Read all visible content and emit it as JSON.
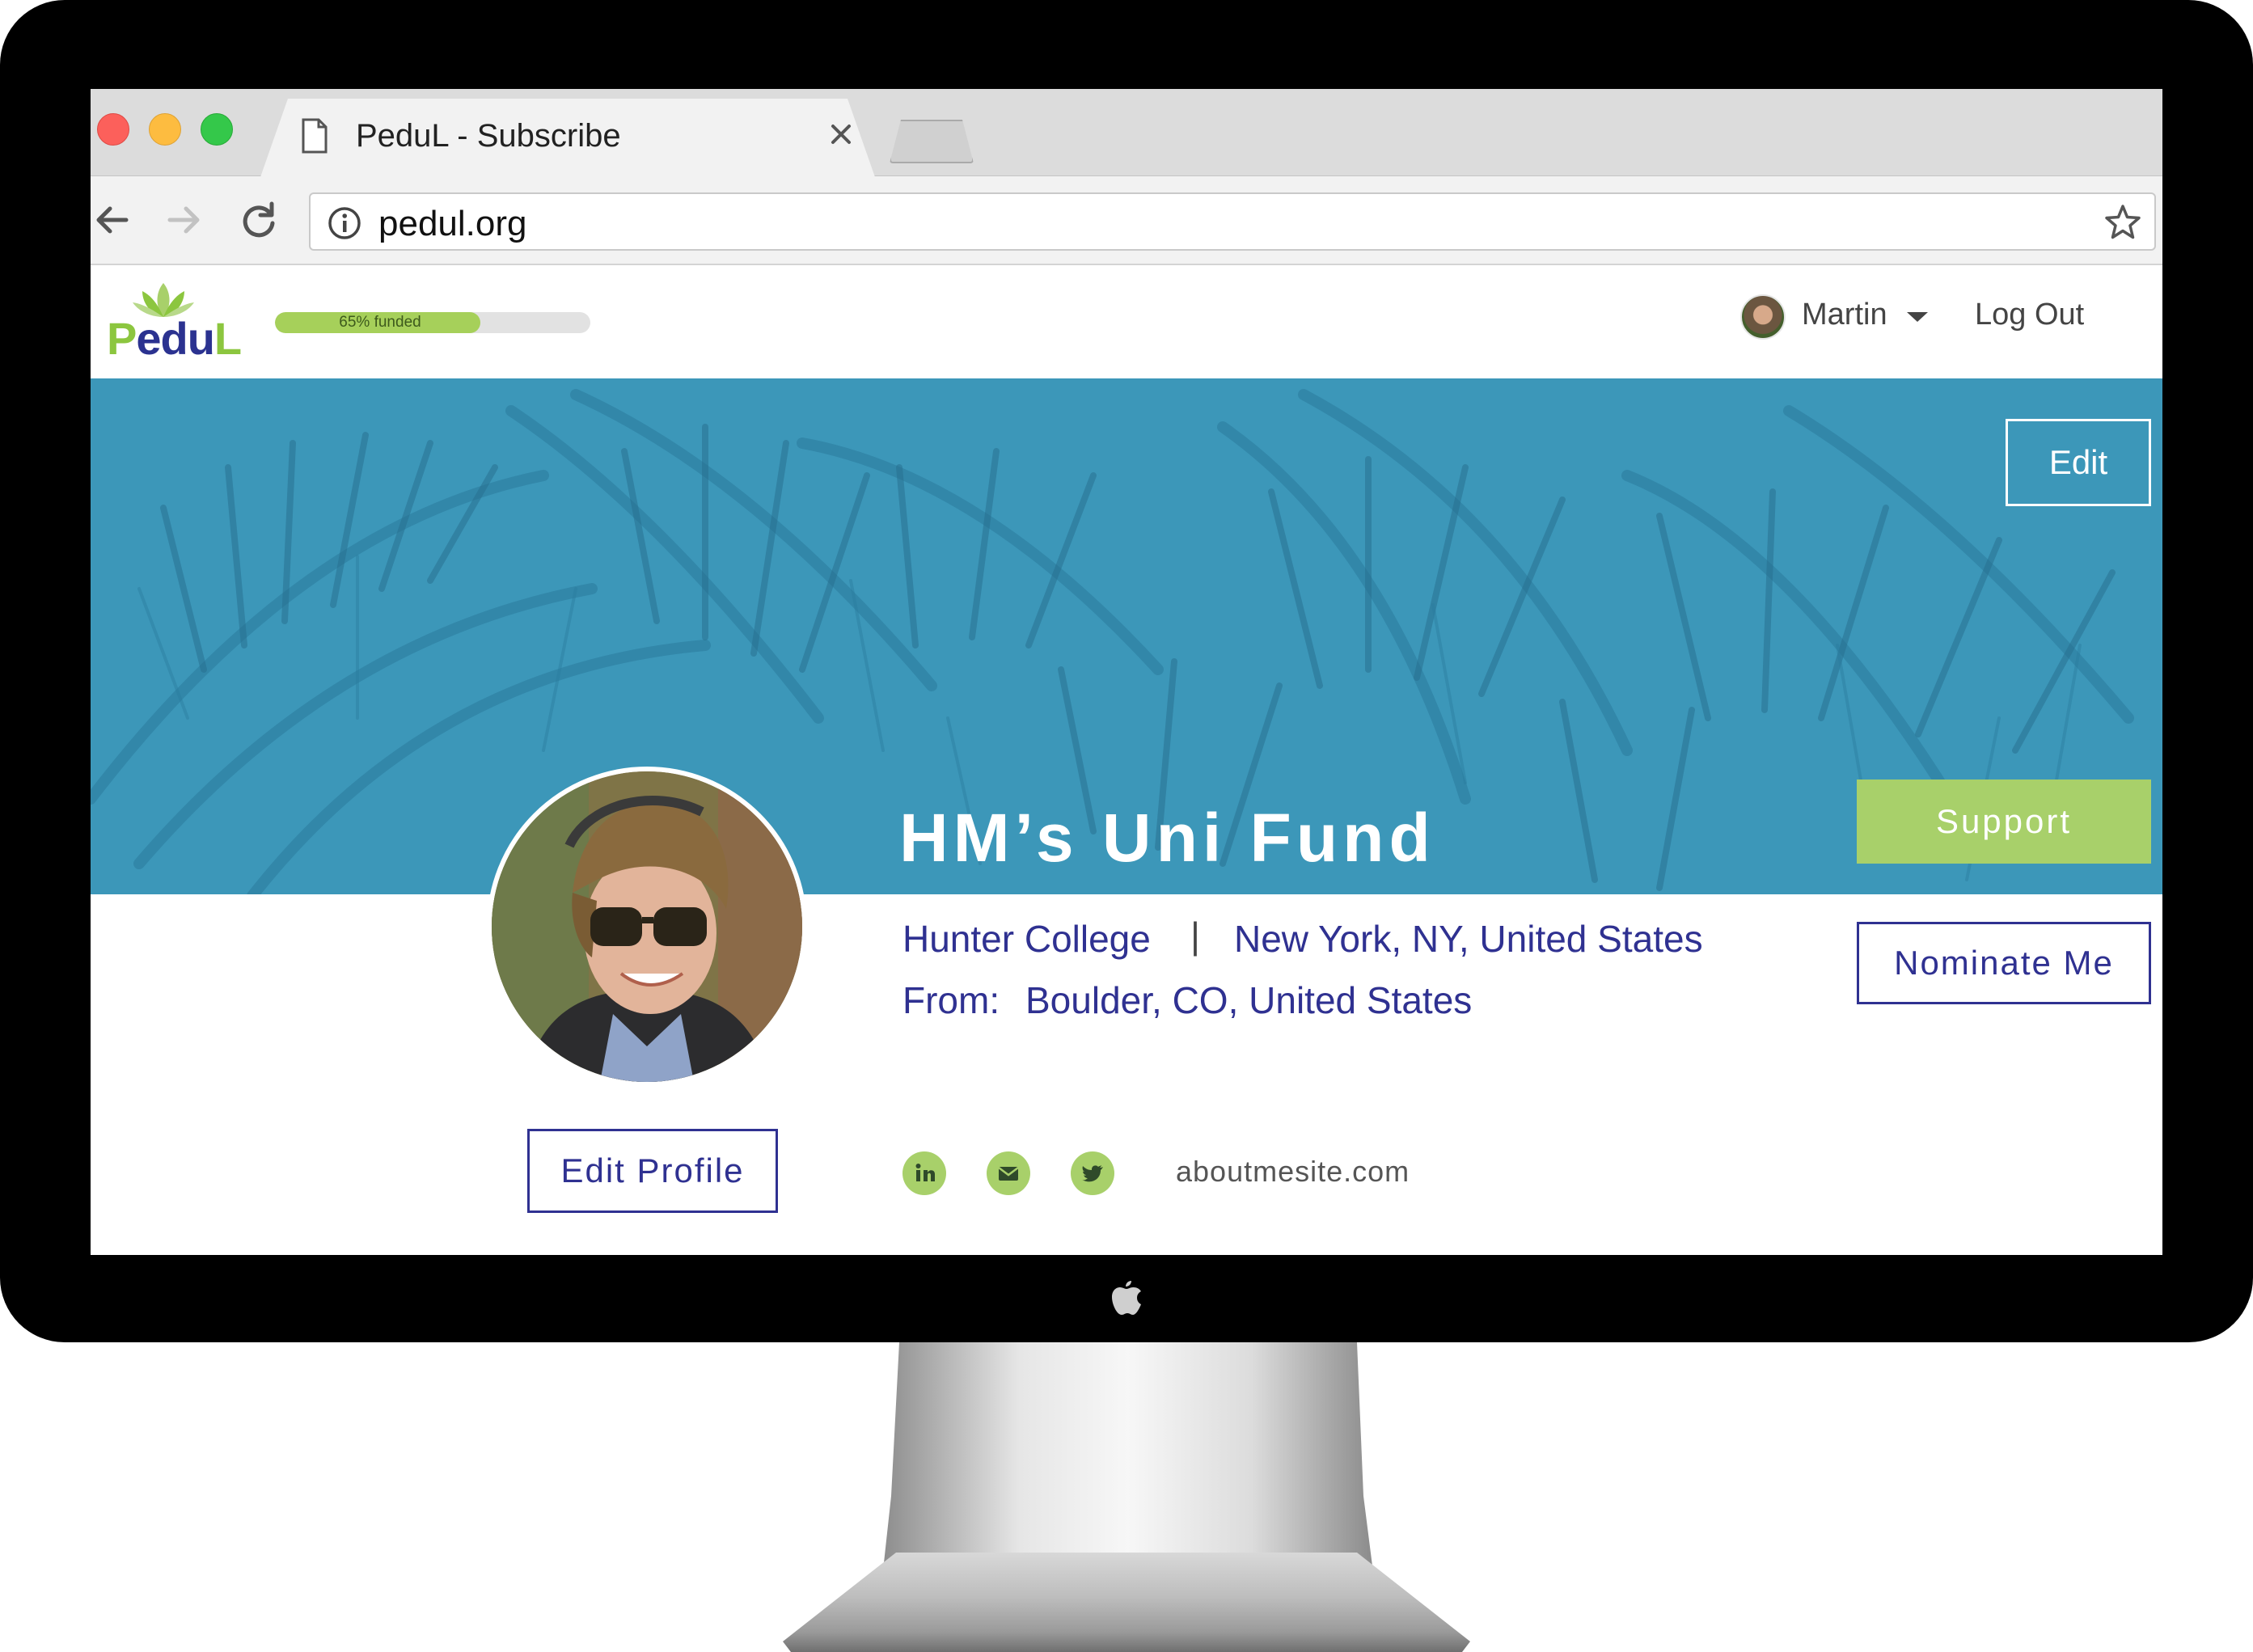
{
  "browser": {
    "tab_title": "PeduL - Subscribe",
    "url": "pedul.org"
  },
  "site": {
    "logo_text": "PeduL",
    "funding_label": "65% funded",
    "funding_fraction": 0.65,
    "user_name": "Martin",
    "logout_label": "Log Out"
  },
  "hero": {
    "edit_label": "Edit",
    "title": "HM’s Uni Fund",
    "support_label": "Support"
  },
  "profile": {
    "college": "Hunter College",
    "divider": "|",
    "location": "New York, NY, United States",
    "from_label": "From:",
    "from_value": "Boulder, CO, United States",
    "nominate_label": "Nominate Me",
    "edit_profile_label": "Edit Profile",
    "website": "aboutmesite.com"
  },
  "colors": {
    "brand_navy": "#2f3191",
    "brand_green": "#a8d06a",
    "hero_blue": "#3c97b9"
  },
  "icons": [
    "document-icon",
    "close-icon",
    "back-arrow-icon",
    "forward-arrow-icon",
    "reload-icon",
    "info-icon",
    "star-icon",
    "caret-down-icon",
    "linkedin-icon",
    "email-icon",
    "twitter-icon",
    "apple-logo-icon"
  ]
}
